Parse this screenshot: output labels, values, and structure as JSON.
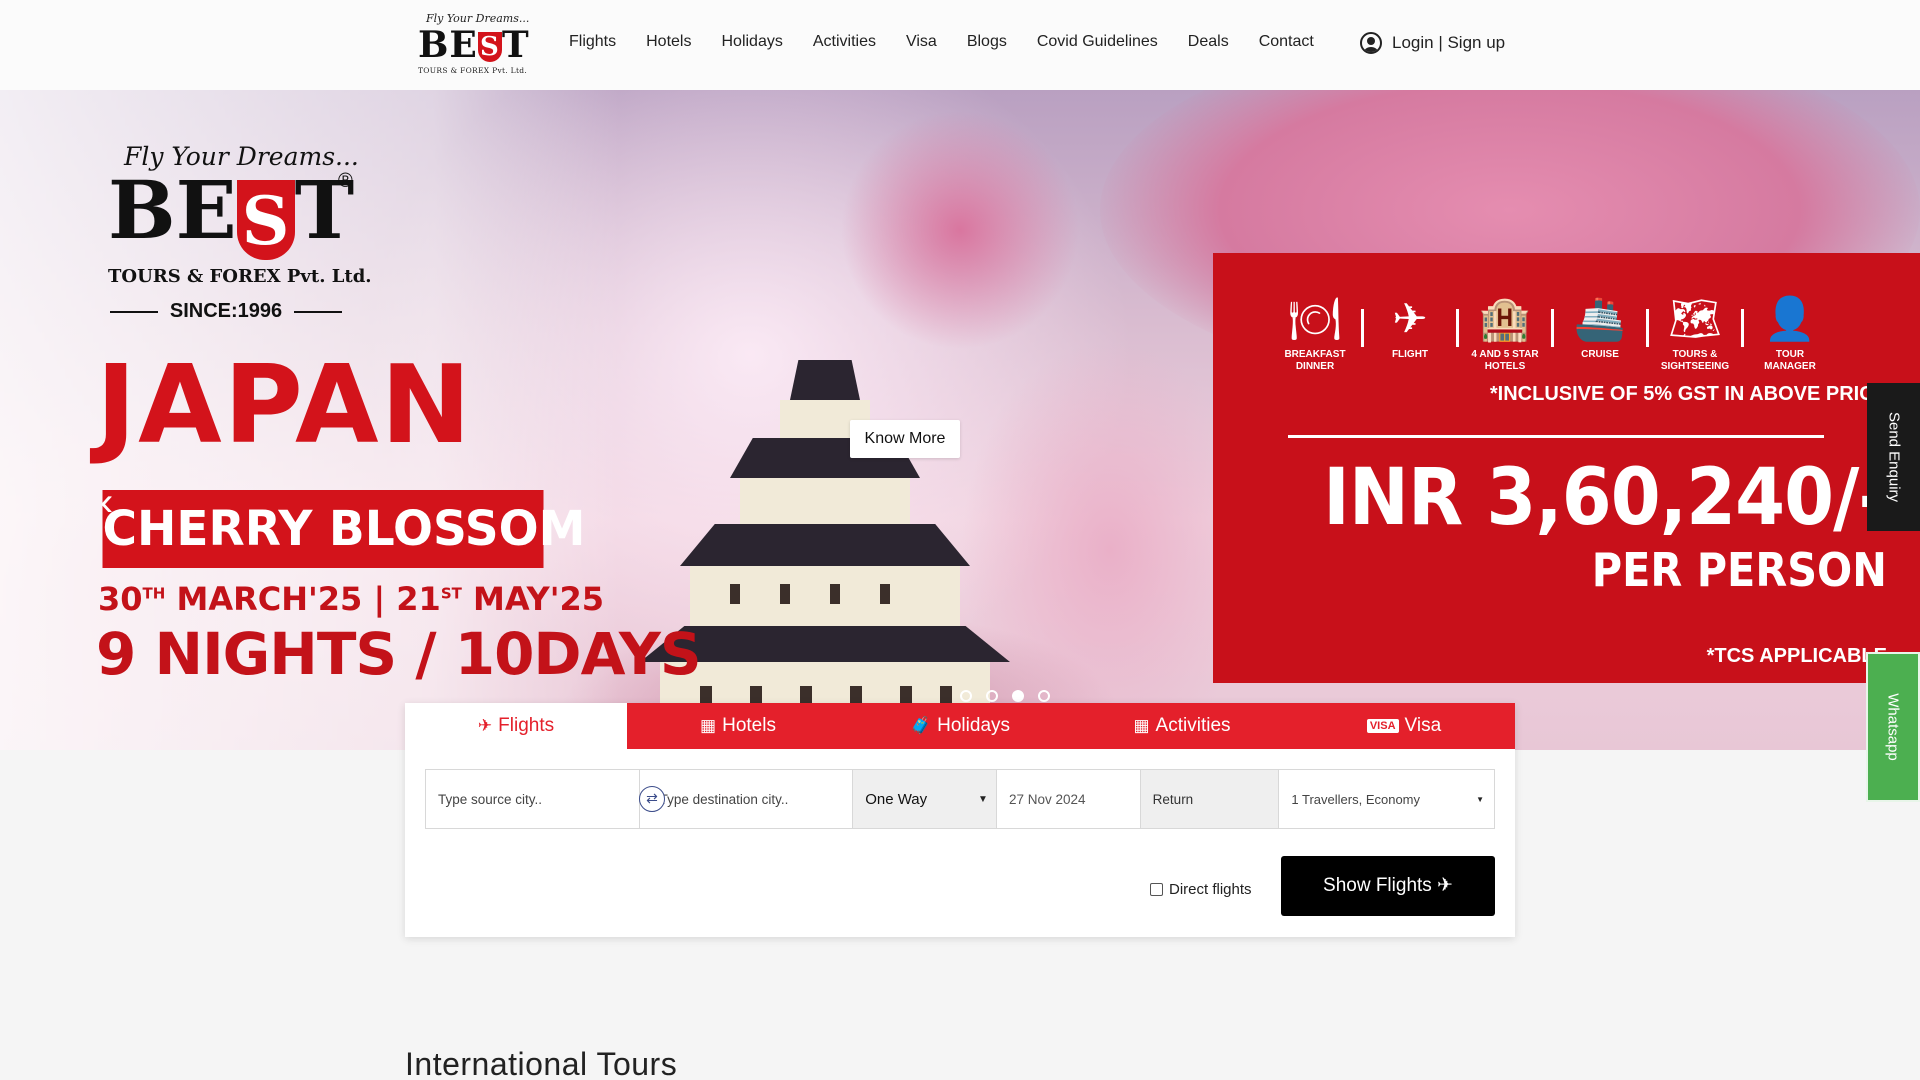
{
  "header": {
    "logo": {
      "tagline": "Fly Your Dreams...",
      "brand_left": "BE",
      "brand_s": "S",
      "brand_right": "T",
      "subtitle": "TOURS & FOREX Pvt. Ltd."
    },
    "nav": [
      "Flights",
      "Hotels",
      "Holidays",
      "Activities",
      "Visa",
      "Blogs",
      "Covid Guidelines",
      "Deals",
      "Contact"
    ],
    "login_label": "Login | Sign up"
  },
  "hero": {
    "logo": {
      "tagline": "Fly Your Dreams...",
      "brand_left": "BE",
      "brand_s": "S",
      "brand_right": "T",
      "registered": "®",
      "subtitle": "TOURS & FOREX Pvt. Ltd.",
      "since": "SINCE:1996"
    },
    "destination": "JAPAN",
    "theme": "CHERRY BLOSSOM",
    "date_start_day": "30",
    "date_start_suffix": "TH",
    "date_start_month": "MARCH'25",
    "date_sep": "|",
    "date_end_day": "21",
    "date_end_suffix": "ST",
    "date_end_month": "MAY'25",
    "duration": "9 NIGHTS / 10DAYS",
    "know_more": "Know More",
    "prev_arrow": "‹",
    "slide_count": 4,
    "active_slide": 3,
    "inclusions": [
      {
        "icon": "dining-icon",
        "glyph": "🍽",
        "label": "BREAKFAST\nDINNER"
      },
      {
        "icon": "flight-icon",
        "glyph": "✈",
        "label": "FLIGHT"
      },
      {
        "icon": "hotel-icon",
        "glyph": "🏨",
        "label": "4 AND 5 STAR\nHOTELS"
      },
      {
        "icon": "cruise-icon",
        "glyph": "🚢",
        "label": "CRUISE"
      },
      {
        "icon": "map-icon",
        "glyph": "🗺",
        "label": "TOURS &\nSIGHTSEEING"
      },
      {
        "icon": "tour-manager-icon",
        "glyph": "👤",
        "label": "TOUR\nMANAGER"
      }
    ],
    "gst_note": "*INCLUSIVE OF 5% GST IN ABOVE PRICE",
    "price": "INR 3,60,240/-",
    "per_person": "PER PERSON",
    "tcs_note": "*TCS APPLICABLE"
  },
  "side": {
    "enquiry": "Send Enquiry",
    "whatsapp": "Whatsapp"
  },
  "search": {
    "tabs": [
      {
        "label": "Flights",
        "icon": "plane-icon",
        "glyph": "✈",
        "active": true
      },
      {
        "label": "Hotels",
        "icon": "building-icon",
        "glyph": "▦",
        "active": false
      },
      {
        "label": "Holidays",
        "icon": "suitcase-icon",
        "glyph": "🧳",
        "active": false
      },
      {
        "label": "Activities",
        "icon": "building-icon",
        "glyph": "▦",
        "active": false
      },
      {
        "label": "Visa",
        "icon": "visa-card-icon",
        "glyph": "VISA",
        "active": false
      }
    ],
    "source_placeholder": "Type source city..",
    "destination_placeholder": "Type destination city..",
    "trip_type": "One Way",
    "depart_date": "27 Nov 2024",
    "return_label": "Return",
    "travellers": "1 Travellers, Economy",
    "direct_flights": "Direct flights",
    "show_button": "Show Flights ✈"
  },
  "section_title": "International Tours",
  "colors": {
    "brand_red": "#d3131b",
    "panel_red": "#c8101a",
    "tab_red": "#e4202b",
    "whatsapp_green": "#4caf50"
  }
}
